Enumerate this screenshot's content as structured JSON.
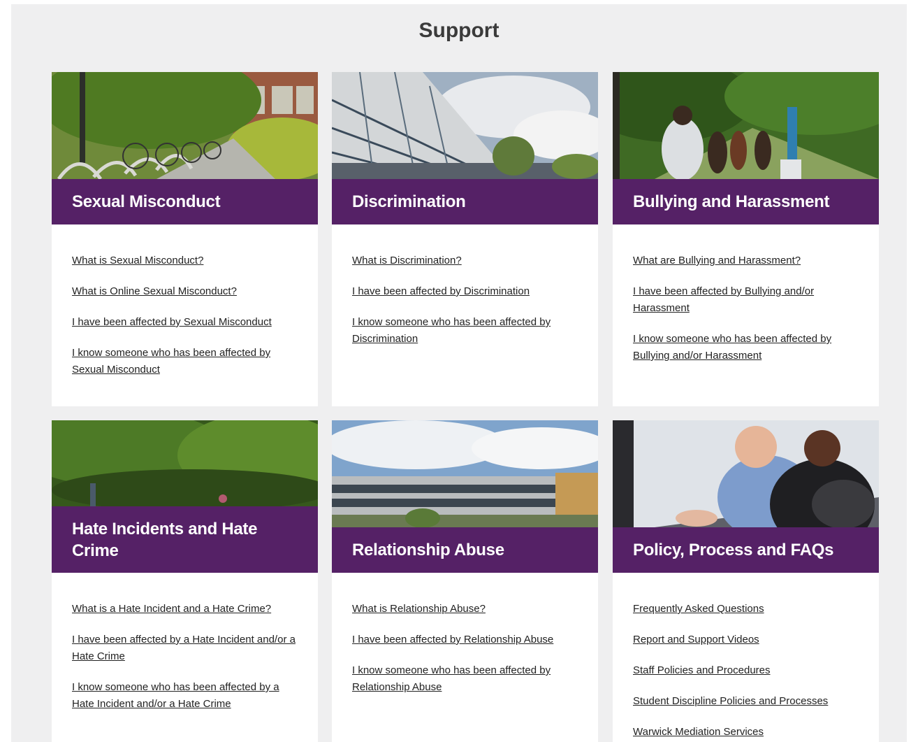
{
  "page": {
    "title": "Support"
  },
  "cards": [
    {
      "title": "Sexual Misconduct",
      "image": "campus-bike-rack-photo",
      "links": [
        "What is Sexual Misconduct?",
        "What is Online Sexual Misconduct?",
        "I have been affected by Sexual Misconduct",
        "I know someone who has been affected by Sexual Misconduct"
      ]
    },
    {
      "title": "Discrimination",
      "image": "campus-building-sky-photo",
      "links": [
        "What is Discrimination?",
        "I have been affected by Discrimination",
        "I know someone who has been affected by Discrimination"
      ]
    },
    {
      "title": "Bullying and Harassment",
      "image": "students-walking-trees-photo",
      "links": [
        "What are Bullying and Harassment?",
        "I have been affected by Bullying and/or Harassment",
        "I know someone who has been affected by Bullying and/or Harassment"
      ]
    },
    {
      "title": "Hate Incidents and Hate Crime",
      "image": "campus-woodland-photo",
      "links": [
        "What is a Hate Incident and a Hate Crime?",
        "I have been affected by a Hate Incident and/or a Hate Crime",
        "I know someone who has been affected by a Hate Incident and/or a Hate Crime"
      ]
    },
    {
      "title": "Relationship Abuse",
      "image": "campus-library-building-photo",
      "links": [
        "What is Relationship Abuse?",
        "I have been affected by Relationship Abuse",
        "I know someone who has been affected by Relationship Abuse"
      ]
    },
    {
      "title": "Policy, Process and FAQs",
      "image": "staff-meeting-photo",
      "links": [
        "Frequently Asked Questions",
        "Report and Support Videos",
        "Staff Policies and Procedures",
        "Student Discipline Policies and Processes",
        "Warwick Mediation Services"
      ]
    }
  ],
  "colors": {
    "accent": "#552166",
    "background": "#efeff0",
    "link": "#222222"
  }
}
